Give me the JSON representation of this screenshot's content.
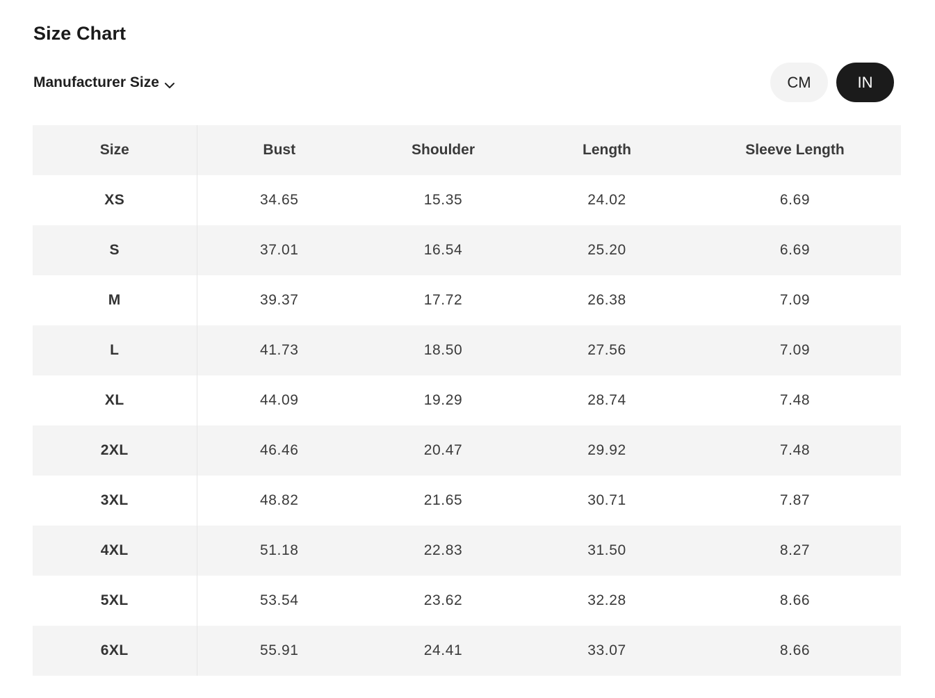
{
  "title": "Size Chart",
  "size_selector": {
    "label": "Manufacturer Size",
    "icon": "chevron-down-icon"
  },
  "units": {
    "cm_label": "CM",
    "in_label": "IN",
    "selected": "IN"
  },
  "table": {
    "headers": [
      "Size",
      "Bust",
      "Shoulder",
      "Length",
      "Sleeve Length"
    ],
    "rows": [
      [
        "XS",
        "34.65",
        "15.35",
        "24.02",
        "6.69"
      ],
      [
        "S",
        "37.01",
        "16.54",
        "25.20",
        "6.69"
      ],
      [
        "M",
        "39.37",
        "17.72",
        "26.38",
        "7.09"
      ],
      [
        "L",
        "41.73",
        "18.50",
        "27.56",
        "7.09"
      ],
      [
        "XL",
        "44.09",
        "19.29",
        "28.74",
        "7.48"
      ],
      [
        "2XL",
        "46.46",
        "20.47",
        "29.92",
        "7.48"
      ],
      [
        "3XL",
        "48.82",
        "21.65",
        "30.71",
        "7.87"
      ],
      [
        "4XL",
        "51.18",
        "22.83",
        "31.50",
        "8.27"
      ],
      [
        "5XL",
        "53.54",
        "23.62",
        "32.28",
        "8.66"
      ],
      [
        "6XL",
        "55.91",
        "24.41",
        "33.07",
        "8.66"
      ]
    ]
  },
  "colors": {
    "active_toggle_bg": "#1b1b1b",
    "inactive_toggle_bg": "#f3f3f3",
    "stripe_bg": "#f4f4f4"
  }
}
